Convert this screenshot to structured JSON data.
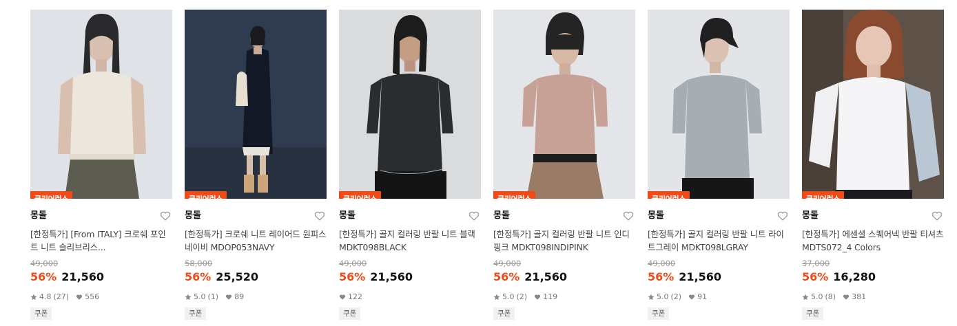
{
  "badge_label": "클리어런스",
  "coupon_label": "쿠폰",
  "products": [
    {
      "brand": "몽돌",
      "title": "[한정특가] [From ITALY] 크로쉐 포인트 니트 슬리브리스...",
      "original_price": "49,000",
      "discount": "56%",
      "price": "21,560",
      "rating": "4.8",
      "reviews": "(27)",
      "likes": "556",
      "image_icon": "model-sleeveless-knit-photo"
    },
    {
      "brand": "몽돌",
      "title": "[한정특가] 크로쉐 니트 레이어드 원피스 네이비 MDOP053NAVY",
      "original_price": "58,000",
      "discount": "56%",
      "price": "25,520",
      "rating": "5.0",
      "reviews": "(1)",
      "likes": "89",
      "image_icon": "model-navy-dress-photo"
    },
    {
      "brand": "몽돌",
      "title": "[한정특가] 골지 컬러링 반팔 니트 블랙 MDKT098BLACK",
      "original_price": "49,000",
      "discount": "56%",
      "price": "21,560",
      "rating": "",
      "reviews": "",
      "likes": "122",
      "image_icon": "model-black-knit-photo"
    },
    {
      "brand": "몽돌",
      "title": "[한정특가] 골지 컬러링 반팔 니트 인디핑크 MDKT098INDIPINK",
      "original_price": "49,000",
      "discount": "56%",
      "price": "21,560",
      "rating": "5.0",
      "reviews": "(2)",
      "likes": "119",
      "image_icon": "model-pink-knit-photo"
    },
    {
      "brand": "몽돌",
      "title": "[한정특가] 골지 컬러링 반팔 니트 라이트그레이 MDKT098LGRAY",
      "original_price": "49,000",
      "discount": "56%",
      "price": "21,560",
      "rating": "5.0",
      "reviews": "(2)",
      "likes": "91",
      "image_icon": "model-gray-knit-photo"
    },
    {
      "brand": "몽돌",
      "title": "[한정특가] 에센셜 스퀘어넥 반팔 티셔츠 MDTS072_4 Colors",
      "original_price": "37,000",
      "discount": "56%",
      "price": "16,280",
      "rating": "5.0",
      "reviews": "(8)",
      "likes": "381",
      "image_icon": "model-white-tee-photo"
    }
  ],
  "colors": {
    "accent": "#f04a16",
    "badge_text": "#ffffff",
    "strike": "#999999"
  }
}
